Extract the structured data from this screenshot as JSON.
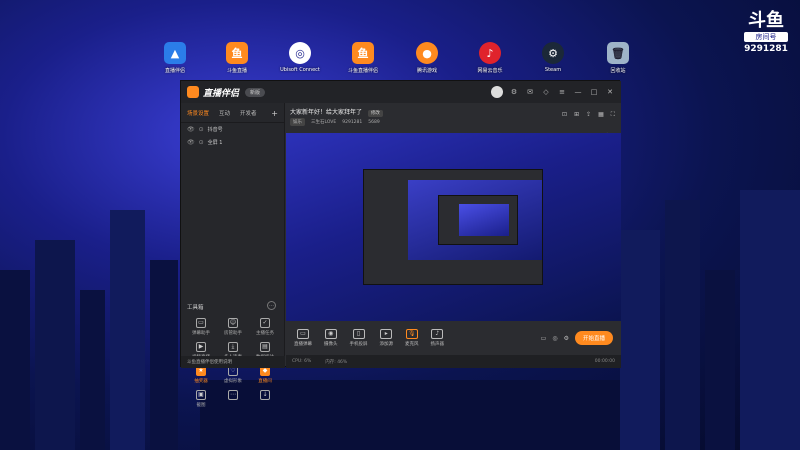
{
  "desktop": {
    "icons": [
      {
        "label": "直播伴侣",
        "icon": "douyu-companion-icon",
        "color": "#2b7de9"
      },
      {
        "label": "斗鱼直播",
        "icon": "douyu-orange-icon",
        "color": "#ff8a1f"
      },
      {
        "label": "Ubisoft Connect",
        "icon": "ubisoft-icon",
        "color": "#ffffff"
      },
      {
        "label": "斗鱼直播伴侣",
        "icon": "douyu-orange-icon",
        "color": "#ff8a1f"
      },
      {
        "label": "腾讯游戏",
        "icon": "tencent-game-icon",
        "color": "#ff8a1f"
      },
      {
        "label": "网易云音乐",
        "icon": "netease-music-icon",
        "color": "#e0232c"
      },
      {
        "label": "Steam",
        "icon": "steam-icon",
        "color": "#1b2838"
      },
      {
        "label": "回收站",
        "icon": "recycle-bin-icon",
        "color": "#9fb4c8"
      }
    ]
  },
  "watermark": {
    "logo": "斗鱼",
    "sub": "房间号",
    "room": "9291281"
  },
  "app": {
    "title": "直播伴侣",
    "version": "新版",
    "tabs": [
      "场景设置",
      "互动",
      "开发者"
    ],
    "scenes": [
      "抖音号",
      "全屏 1"
    ],
    "room_title": "大家新年好！给大家拜年了",
    "room_edit": "修改",
    "meta": {
      "tag": "娱乐",
      "category": "三生石LOVE",
      "room_id": "9291281",
      "fans": "5689"
    },
    "tools_title": "工具箱",
    "tools": [
      {
        "label": "弹幕助手",
        "icon": "danmu-icon",
        "orange": false
      },
      {
        "label": "房管助手",
        "icon": "manager-icon",
        "orange": false
      },
      {
        "label": "主播任务",
        "icon": "task-icon",
        "orange": false
      },
      {
        "label": "视频直播",
        "icon": "video-icon",
        "orange": false
      },
      {
        "label": "多人连麦",
        "icon": "multi-mic-icon",
        "orange": false
      },
      {
        "label": "数据统计",
        "icon": "stats-icon",
        "orange": false
      },
      {
        "label": "抽奖器",
        "icon": "lottery-icon",
        "orange": true
      },
      {
        "label": "虚拟形象",
        "icon": "avatar-virtual-icon",
        "orange": false
      },
      {
        "label": "直播间",
        "icon": "room-icon",
        "orange": true
      },
      {
        "label": "截图",
        "icon": "screenshot-icon",
        "orange": false
      },
      {
        "label": "",
        "icon": "more-icon",
        "orange": false
      },
      {
        "label": "",
        "icon": "download-icon",
        "orange": false
      }
    ],
    "notice": "斗鱼直播伴侣使用说明",
    "bottom_items": [
      {
        "label": "直播弹幕",
        "icon": "danmu-screen-icon"
      },
      {
        "label": "摄像头",
        "icon": "camera-icon"
      },
      {
        "label": "手机投屏",
        "icon": "phone-cast-icon"
      },
      {
        "label": "添加源",
        "icon": "add-source-icon"
      },
      {
        "label": "麦克风",
        "icon": "mic-icon"
      },
      {
        "label": "扬声器",
        "icon": "speaker-icon"
      }
    ],
    "go_live": "开始直播",
    "status": {
      "left1": "CPU: 6%",
      "left2": "内存: 46%",
      "timer": "00:00:00"
    }
  }
}
